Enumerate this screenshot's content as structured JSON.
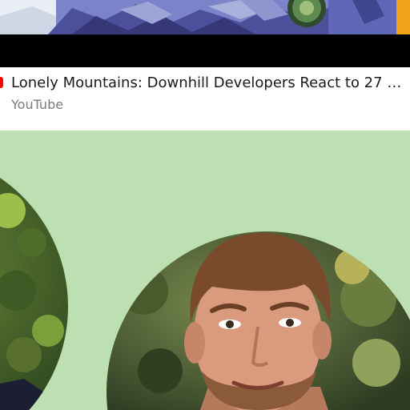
{
  "link_card": {
    "title": "Lonely Mountains: Downhill Developers React to 27 Mi...",
    "source": "YouTube"
  },
  "icons": {
    "source_logo": "youtube-logo-icon"
  },
  "colors": {
    "section_background": "#bde0b3",
    "card_background": "#ffffff",
    "title_text": "#1a1a1a",
    "source_text": "#7a7a7a",
    "video_bar": "#000000"
  }
}
